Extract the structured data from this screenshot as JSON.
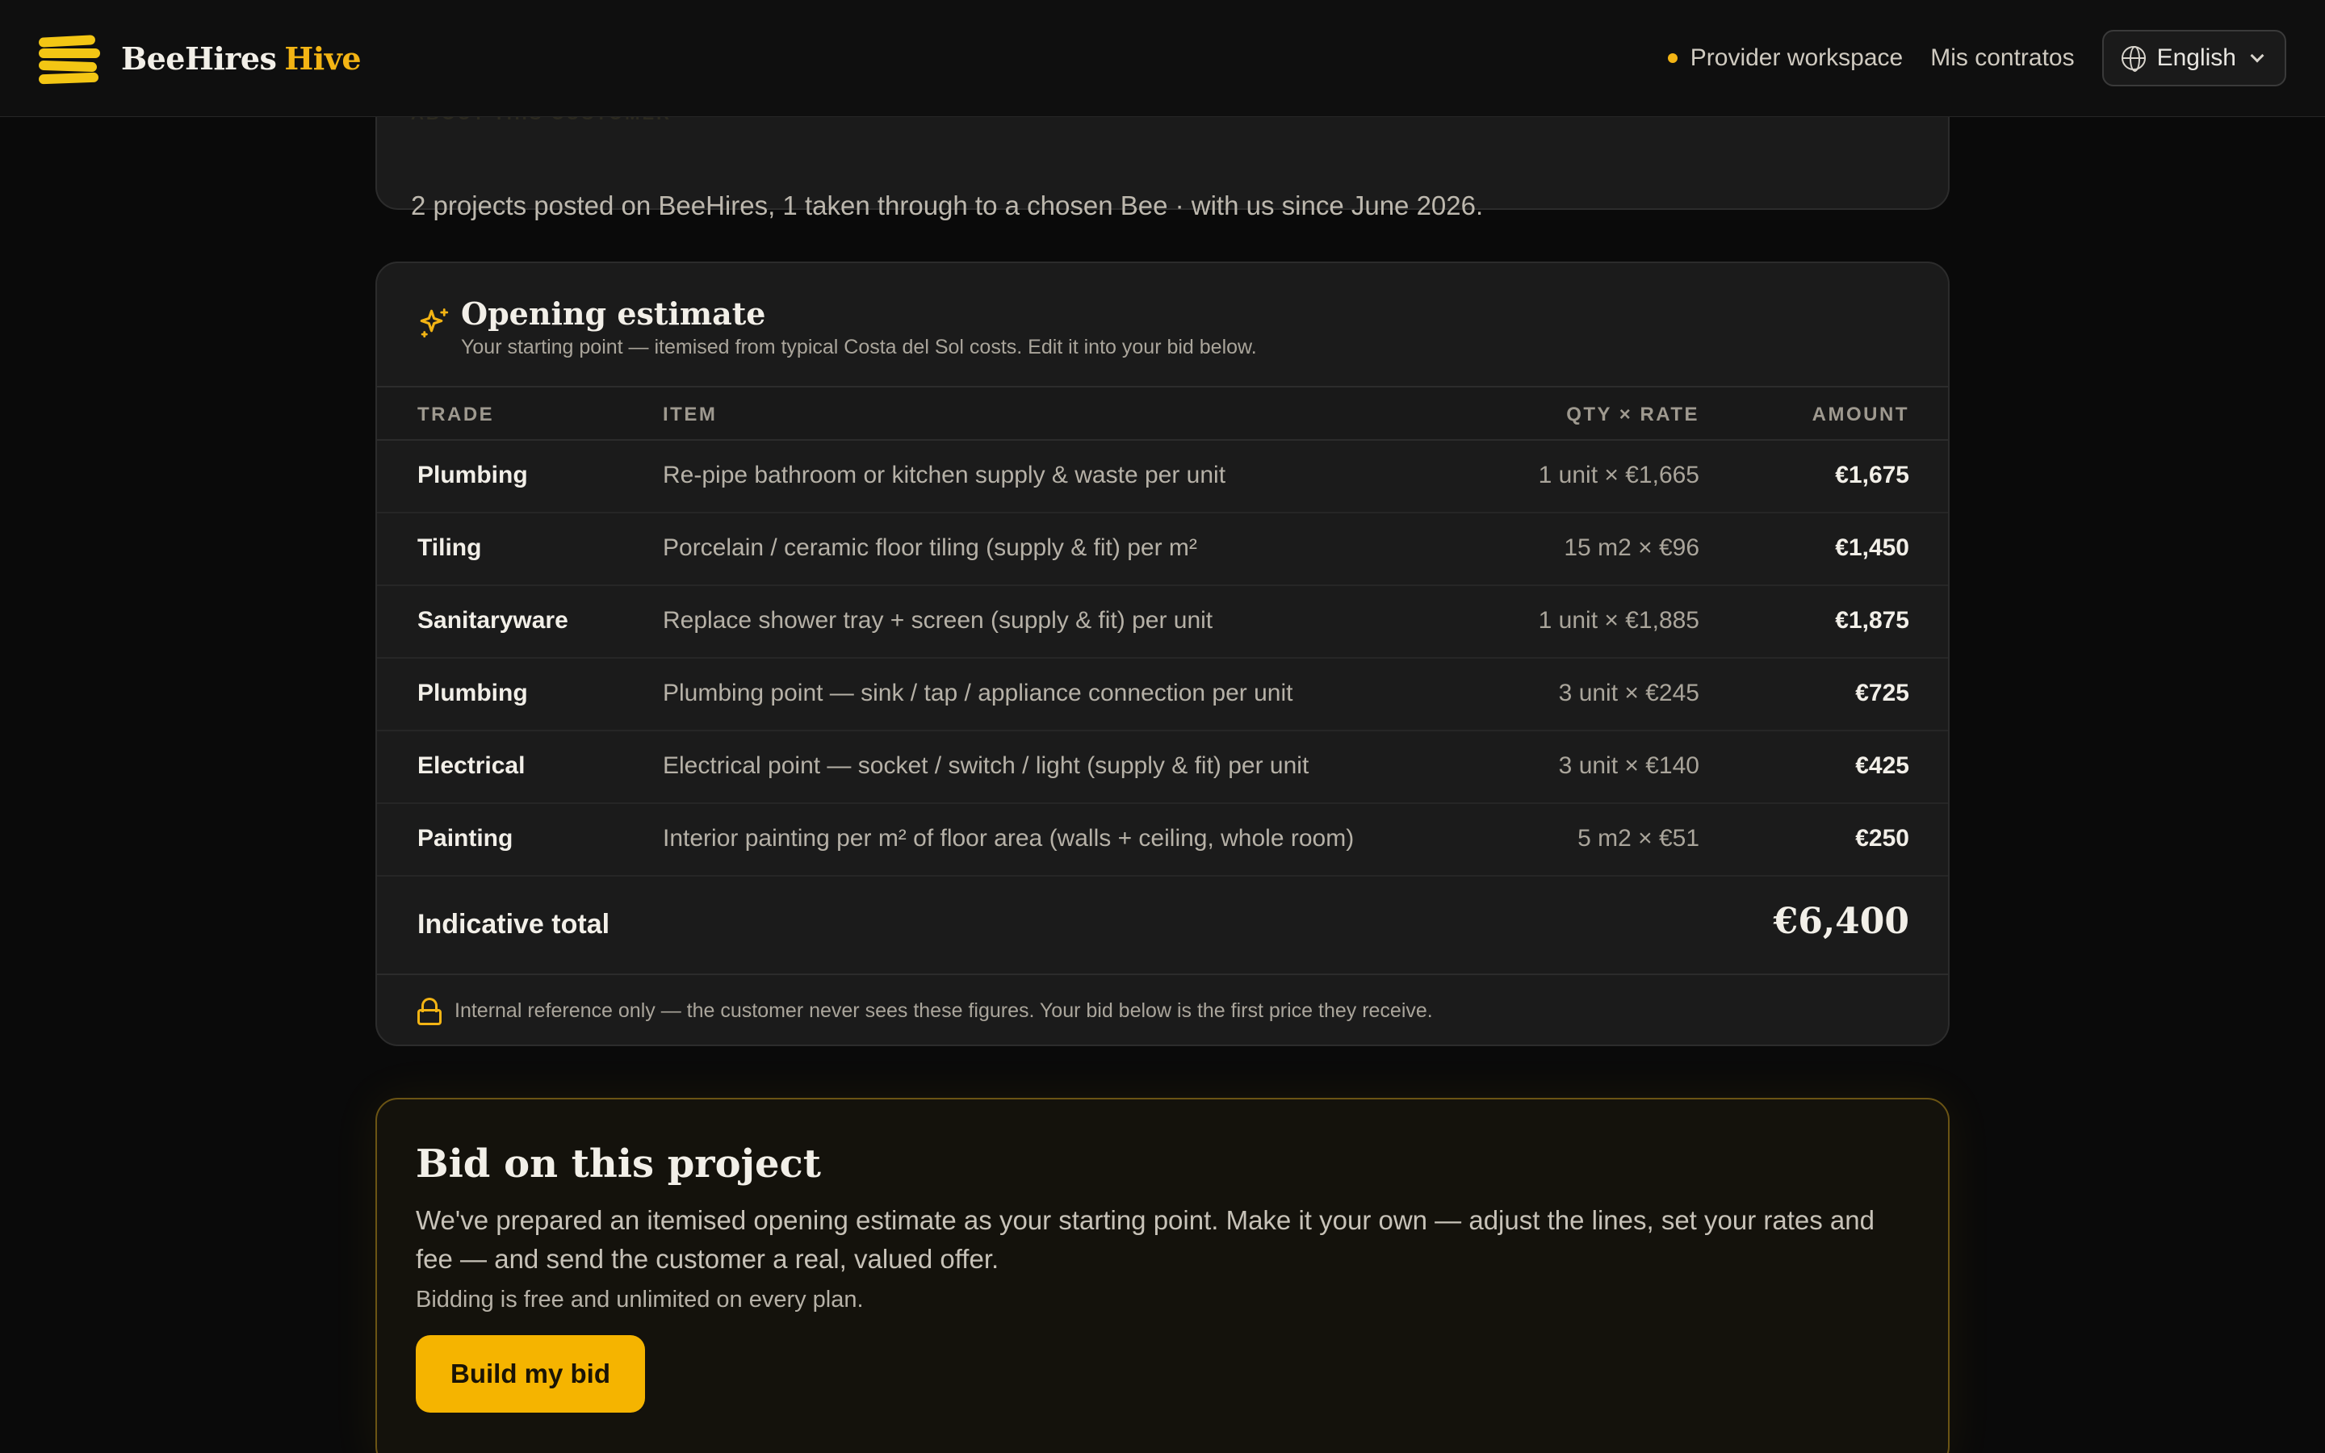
{
  "header": {
    "brand_main": "BeeHires",
    "brand_accent": "Hive",
    "workspace_label": "Provider workspace",
    "contracts_label": "Mis contratos",
    "language": "English"
  },
  "about": {
    "label": "ABOUT THIS CUSTOMER",
    "text": "2 projects posted on BeeHires, 1 taken through to a chosen Bee · with us since June 2026."
  },
  "estimate": {
    "title": "Opening estimate",
    "subtitle": "Your starting point — itemised from typical Costa del Sol costs. Edit it into your bid below.",
    "columns": {
      "trade": "TRADE",
      "item": "ITEM",
      "qty": "QTY × RATE",
      "amount": "AMOUNT"
    },
    "rows": [
      {
        "trade": "Plumbing",
        "item": "Re-pipe bathroom or kitchen supply & waste per unit",
        "qty": "1 unit × €1,665",
        "amount": "€1,675"
      },
      {
        "trade": "Tiling",
        "item": "Porcelain / ceramic floor tiling (supply & fit) per m²",
        "qty": "15 m2 × €96",
        "amount": "€1,450"
      },
      {
        "trade": "Sanitaryware",
        "item": "Replace shower tray + screen (supply & fit) per unit",
        "qty": "1 unit × €1,885",
        "amount": "€1,875"
      },
      {
        "trade": "Plumbing",
        "item": "Plumbing point — sink / tap / appliance connection per unit",
        "qty": "3 unit × €245",
        "amount": "€725"
      },
      {
        "trade": "Electrical",
        "item": "Electrical point — socket / switch / light (supply & fit) per unit",
        "qty": "3 unit × €140",
        "amount": "€425"
      },
      {
        "trade": "Painting",
        "item": "Interior painting per m² of floor area (walls + ceiling, whole room)",
        "qty": "5 m2 × €51",
        "amount": "€250"
      }
    ],
    "total_label": "Indicative total",
    "total_value": "€6,400",
    "note": "Internal reference only — the customer never sees these figures. Your bid below is the first price they receive."
  },
  "bid": {
    "title": "Bid on this project",
    "description": "We've prepared an itemised opening estimate as your starting point. Make it your own — adjust the lines, set your rates and fee — and send the customer a real, valued offer.",
    "free_note": "Bidding is free and unlimited on every plan.",
    "button_label": "Build my bid"
  },
  "colors": {
    "accent": "#f3b414",
    "background": "#0a0a0a",
    "card": "#1b1b1b"
  }
}
